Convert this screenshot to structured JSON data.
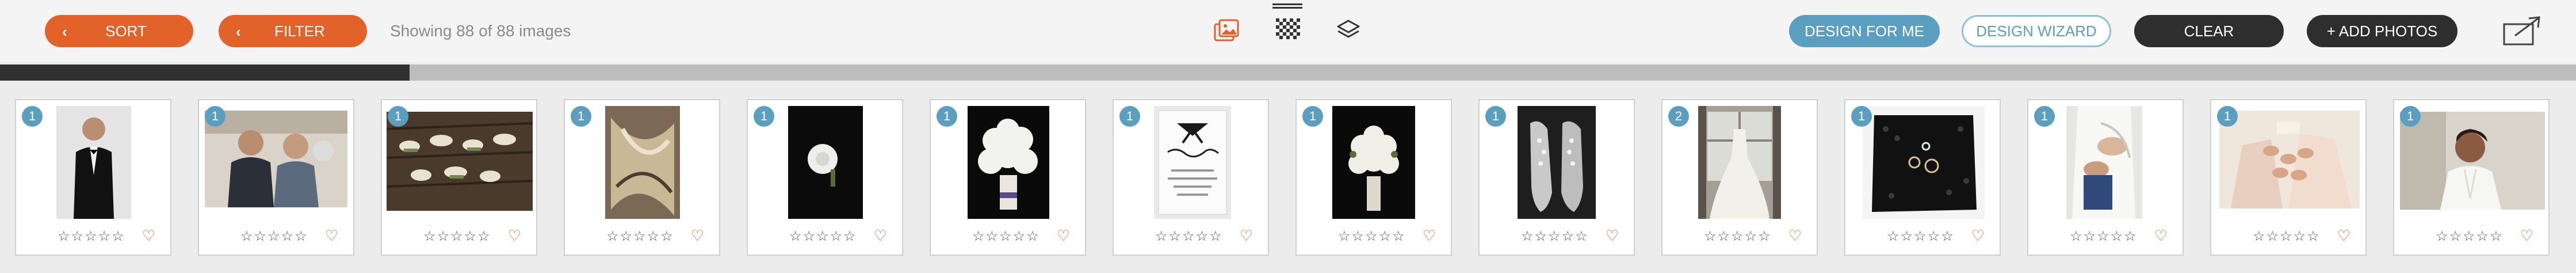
{
  "toolbar": {
    "sort_label": "SORT",
    "filter_label": "FILTER",
    "status_text": "Showing 88 of 88 images",
    "design_for_me_label": "DESIGN FOR ME",
    "design_wizard_label": "DESIGN WIZARD",
    "clear_label": "CLEAR",
    "add_photos_label": "+ ADD PHOTOS",
    "icons": [
      "chevron-left-icon",
      "photos-icon",
      "grid-pattern-icon",
      "layers-icon",
      "export-icon"
    ]
  },
  "progress": {
    "fraction": 0.159
  },
  "colors": {
    "accent_orange": "#e2622a",
    "accent_blue": "#5a9fc0",
    "dark": "#2e2e2e"
  },
  "photos": [
    {
      "count": "1",
      "rating": "☆☆☆☆☆",
      "favorite": "♡",
      "subject": "groom"
    },
    {
      "count": "1",
      "rating": "☆☆☆☆☆",
      "favorite": "♡",
      "subject": "couple-embrace"
    },
    {
      "count": "1",
      "rating": "☆☆☆☆☆",
      "favorite": "♡",
      "subject": "boutonnieres"
    },
    {
      "count": "1",
      "rating": "☆☆☆☆☆",
      "favorite": "♡",
      "subject": "feather-detail"
    },
    {
      "count": "1",
      "rating": "☆☆☆☆☆",
      "favorite": "♡",
      "subject": "single-flower"
    },
    {
      "count": "1",
      "rating": "☆☆☆☆☆",
      "favorite": "♡",
      "subject": "bouquet"
    },
    {
      "count": "1",
      "rating": "☆☆☆☆☆",
      "favorite": "♡",
      "subject": "invitation"
    },
    {
      "count": "1",
      "rating": "☆☆☆☆☆",
      "favorite": "♡",
      "subject": "bouquet-dark"
    },
    {
      "count": "1",
      "rating": "☆☆☆☆☆",
      "favorite": "♡",
      "subject": "shoes"
    },
    {
      "count": "2",
      "rating": "☆☆☆☆☆",
      "favorite": "♡",
      "subject": "gown-window"
    },
    {
      "count": "1",
      "rating": "☆☆☆☆☆",
      "favorite": "♡",
      "subject": "rings-lace"
    },
    {
      "count": "1",
      "rating": "☆☆☆☆☆",
      "favorite": "♡",
      "subject": "dressing"
    },
    {
      "count": "1",
      "rating": "☆☆☆☆☆",
      "favorite": "♡",
      "subject": "bridesmaids"
    },
    {
      "count": "1",
      "rating": "☆☆☆☆☆",
      "favorite": "♡",
      "subject": "bride-robe"
    }
  ]
}
